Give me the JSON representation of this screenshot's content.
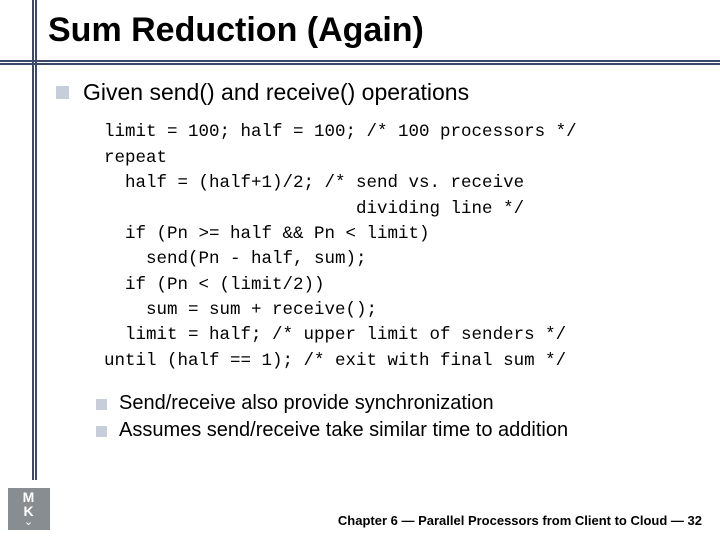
{
  "title": "Sum Reduction (Again)",
  "bullet1": "Given send() and receive() operations",
  "code": "limit = 100; half = 100; /* 100 processors */\nrepeat\n  half = (half+1)/2; /* send vs. receive\n                        dividing line */\n  if (Pn >= half && Pn < limit)\n    send(Pn - half, sum);\n  if (Pn < (limit/2))\n    sum = sum + receive();\n  limit = half; /* upper limit of senders */\nuntil (half == 1); /* exit with final sum */",
  "sub_bullets": [
    "Send/receive also provide synchronization",
    "Assumes send/receive take similar time to addition"
  ],
  "footer": "Chapter 6 — Parallel Processors from Client to Cloud — 32",
  "logo_top": "M",
  "logo_bot": "K"
}
